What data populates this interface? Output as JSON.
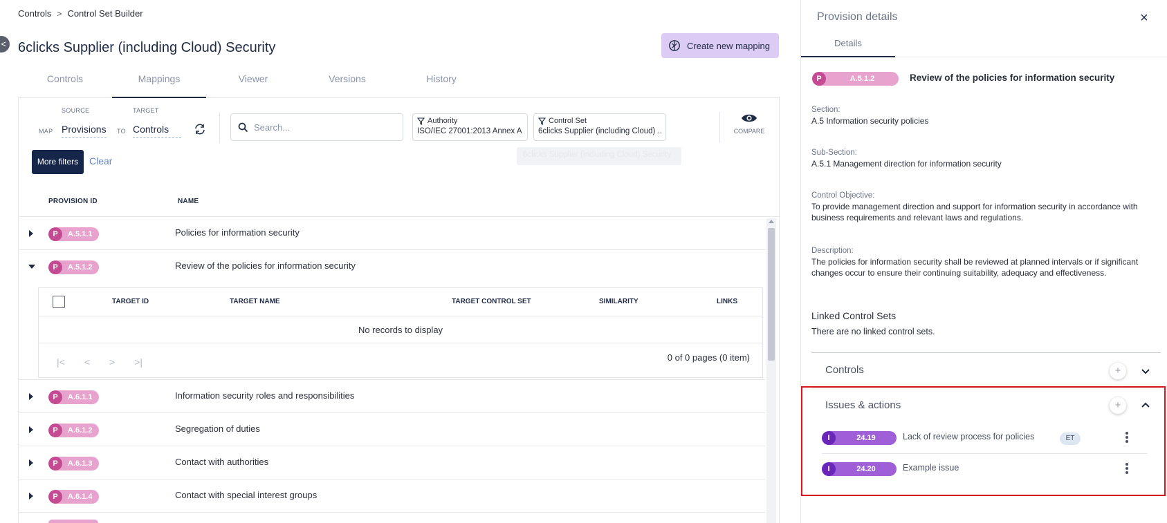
{
  "breadcrumb": {
    "item1": "Controls",
    "separator": ">",
    "item2": "Control Set Builder"
  },
  "collapse_icon": "chevron-left-icon",
  "page_title": "6clicks Supplier (including Cloud) Security",
  "create_mapping_label": "Create new mapping",
  "tabs": [
    {
      "label": "Controls"
    },
    {
      "label": "Mappings",
      "active": true
    },
    {
      "label": "Viewer"
    },
    {
      "label": "Versions"
    },
    {
      "label": "History"
    }
  ],
  "map": {
    "map_label": "MAP",
    "source_label": "SOURCE",
    "source_value": "Provisions",
    "to_label": "TO",
    "target_label": "TARGET",
    "target_value": "Controls"
  },
  "search": {
    "placeholder": "Search..."
  },
  "filters": {
    "authority_label": "Authority",
    "authority_value": "ISO/IEC 27001:2013 Annex A",
    "control_set_label": "Control Set",
    "control_set_value": "6clicks Supplier (including Cloud) ...",
    "control_set_tooltip": "6clicks Supplier (including Cloud) Security"
  },
  "compare_label": "COMPARE",
  "more_filters_label": "More filters",
  "clear_label": "Clear",
  "grid": {
    "col_provision_id": "PROVISION ID",
    "col_name": "NAME",
    "badge_letter": "P",
    "rows": [
      {
        "id": "A.5.1.1",
        "name": "Policies for information security",
        "expanded": false
      },
      {
        "id": "A.5.1.2",
        "name": "Review of the policies for information security",
        "expanded": true
      },
      {
        "id": "A.6.1.1",
        "name": "Information security roles and responsibilities",
        "expanded": false
      },
      {
        "id": "A.6.1.2",
        "name": "Segregation of duties",
        "expanded": false
      },
      {
        "id": "A.6.1.3",
        "name": "Contact with authorities",
        "expanded": false
      },
      {
        "id": "A.6.1.4",
        "name": "Contact with special interest groups",
        "expanded": false
      }
    ]
  },
  "subgrid": {
    "col_target_id": "TARGET ID",
    "col_target_name": "TARGET NAME",
    "col_target_control_set": "TARGET CONTROL SET",
    "col_similarity": "SIMILARITY",
    "col_links": "LINKS",
    "no_records": "No records to display",
    "pager_first": "|<",
    "pager_prev": "<",
    "pager_next": ">",
    "pager_last": ">|",
    "page_info": "0 of 0 pages (0 item)"
  },
  "drawer": {
    "title": "Provision details",
    "close": "×",
    "tab_details": "Details",
    "badge_letter": "P",
    "provision_id": "A.5.1.2",
    "heading": "Review of the policies for information security",
    "section_label": "Section:",
    "section_value": "A.5 Information security policies",
    "subsection_label": "Sub-Section:",
    "subsection_value": "A.5.1 Management direction for information security",
    "objective_label": "Control Objective:",
    "objective_value": "To provide management direction and support for information security in accordance with business requirements and relevant laws and regulations.",
    "description_label": "Description:",
    "description_value": "The policies for information security shall be reviewed at planned intervals or if significant changes occur to ensure their continuing suitability, adequacy and effectiveness.",
    "linked_title": "Linked Control Sets",
    "linked_text": "There are no linked control sets.",
    "controls_title": "Controls",
    "issues_title": "Issues & actions",
    "add_symbol": "+",
    "issue_letter": "I",
    "issues": [
      {
        "id": "24.19",
        "name": "Lack of review process for policies",
        "tag": "ET"
      },
      {
        "id": "24.20",
        "name": "Example issue",
        "tag": ""
      }
    ]
  },
  "colors": {
    "provision_badge": "#e7a3cd",
    "provision_badge_dark": "#c44a92",
    "issue_badge": "#9f5fd6",
    "issue_badge_dark": "#6a26b8",
    "primary_button": "#15264a",
    "mapping_button": "#dccbf4",
    "highlight_border": "#d8181f"
  }
}
